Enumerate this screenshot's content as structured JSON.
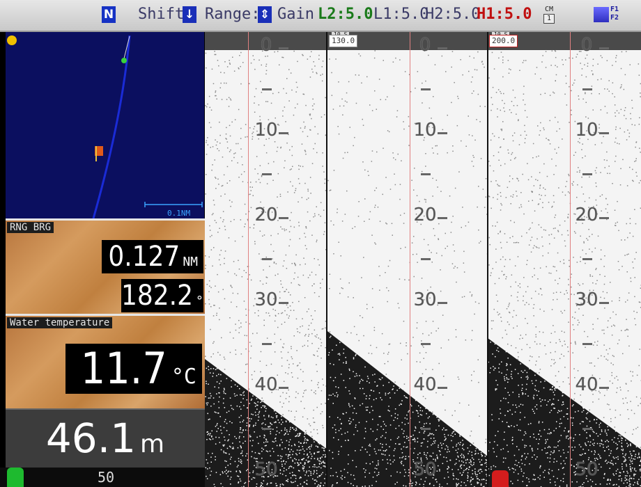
{
  "topbar": {
    "mode_badge": "N",
    "shift_label": "Shift:",
    "range_label": "Range:",
    "gain_label": "Gain",
    "gain_L2": "L2:5.0",
    "gain_L1": "L1:5.0",
    "gain_H2": "H2:5.0",
    "gain_H1": "H1:5.0",
    "cm_label": "CM",
    "cm_value": "1",
    "f1_label": "F1",
    "f2_label": "F2"
  },
  "map": {
    "scale": "0.1NM"
  },
  "rng_brg": {
    "label": "RNG BRG",
    "range_value": "0.127",
    "range_unit": "NM",
    "bearing_value": "182.2",
    "bearing_unit": "°"
  },
  "water_temp": {
    "label": "Water temperature",
    "value": "11.7",
    "unit": "°C"
  },
  "depth": {
    "value": "46.1",
    "unit": "m",
    "bottom_tick": "50"
  },
  "echo": {
    "scale_ticks": [
      "0",
      "10",
      "20",
      "30",
      "40",
      "50"
    ],
    "pane2_freq_label": "10 S",
    "pane2_freq": "130.0",
    "pane3_freq_label": "10 S",
    "pane3_freq": "200.0"
  },
  "colors": {
    "map_bg": "#0b0f5f",
    "gain_green": "#1a7a1a",
    "gain_red": "#c01010",
    "marker_green": "#1eba2f",
    "marker_red": "#d41d1d"
  }
}
